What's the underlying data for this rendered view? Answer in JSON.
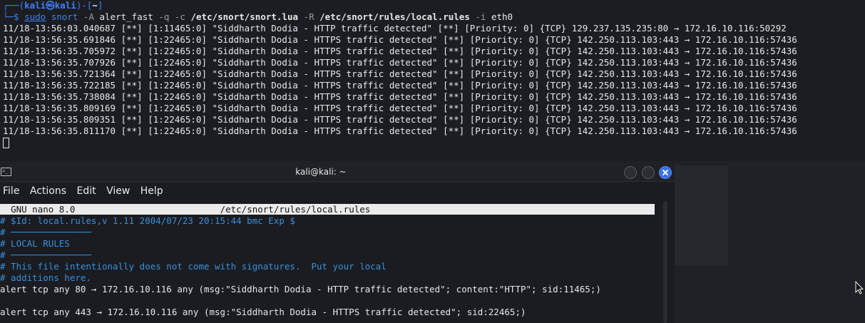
{
  "top_terminal": {
    "prompt": {
      "box_open": "┌──(",
      "user_host": "kali㉿kali",
      "box_close": ")-[",
      "cwd": "~",
      "box_end": "]",
      "arrow": "└─$",
      "sudo": "sudo",
      "cmd": "snort",
      "args": [
        {
          "t": "-A",
          "k": "flag"
        },
        {
          "t": "alert_fast",
          "k": "plain"
        },
        {
          "t": "-q",
          "k": "flag"
        },
        {
          "t": "-c",
          "k": "flag"
        },
        {
          "t": "/etc/snort/snort.lua",
          "k": "path"
        },
        {
          "t": "-R",
          "k": "flag"
        },
        {
          "t": "/etc/snort/rules/local.rules",
          "k": "path"
        },
        {
          "t": "-i",
          "k": "flag"
        },
        {
          "t": "eth0",
          "k": "plain"
        }
      ]
    },
    "alerts": [
      "11/18-13:56:03.040687 [**] [1:11465:0] \"Siddharth Dodia - HTTP traffic detected\" [**] [Priority: 0] {TCP} 129.237.135.235:80 → 172.16.10.116:50292",
      "11/18-13:56:35.691846 [**] [1:22465:0] \"Siddharth Dodia - HTTPS traffic detected\" [**] [Priority: 0] {TCP} 142.250.113.103:443 → 172.16.10.116:57436",
      "11/18-13:56:35.705972 [**] [1:22465:0] \"Siddharth Dodia - HTTPS traffic detected\" [**] [Priority: 0] {TCP} 142.250.113.103:443 → 172.16.10.116:57436",
      "11/18-13:56:35.707926 [**] [1:22465:0] \"Siddharth Dodia - HTTPS traffic detected\" [**] [Priority: 0] {TCP} 142.250.113.103:443 → 172.16.10.116:57436",
      "11/18-13:56:35.721364 [**] [1:22465:0] \"Siddharth Dodia - HTTPS traffic detected\" [**] [Priority: 0] {TCP} 142.250.113.103:443 → 172.16.10.116:57436",
      "11/18-13:56:35.722185 [**] [1:22465:0] \"Siddharth Dodia - HTTPS traffic detected\" [**] [Priority: 0] {TCP} 142.250.113.103:443 → 172.16.10.116:57436",
      "11/18-13:56:35.738084 [**] [1:22465:0] \"Siddharth Dodia - HTTPS traffic detected\" [**] [Priority: 0] {TCP} 142.250.113.103:443 → 172.16.10.116:57436",
      "11/18-13:56:35.809169 [**] [1:22465:0] \"Siddharth Dodia - HTTPS traffic detected\" [**] [Priority: 0] {TCP} 142.250.113.103:443 → 172.16.10.116:57436",
      "11/18-13:56:35.809351 [**] [1:22465:0] \"Siddharth Dodia - HTTPS traffic detected\" [**] [Priority: 0] {TCP} 142.250.113.103:443 → 172.16.10.116:57436",
      "11/18-13:56:35.811170 [**] [1:22465:0] \"Siddharth Dodia - HTTPS traffic detected\" [**] [Priority: 0] {TCP} 142.250.113.103:443 → 172.16.10.116:57436"
    ]
  },
  "nano_window": {
    "title": "kali@kali: ~",
    "menu": [
      "File",
      "Actions",
      "Edit",
      "View",
      "Help"
    ],
    "nano_version": "GNU nano 8.0",
    "filename": "/etc/snort/rules/local.rules",
    "lines": [
      {
        "t": "# $Id: local.rules,v 1.11 2004/07/23 20:15:44 bmc Exp $",
        "k": "comment"
      },
      {
        "t": "# ───────────────",
        "k": "comment"
      },
      {
        "t": "# LOCAL RULES",
        "k": "comment"
      },
      {
        "t": "# ───────────────",
        "k": "comment"
      },
      {
        "t": "# This file intentionally does not come with signatures.  Put your local",
        "k": "comment"
      },
      {
        "t": "# additions here.",
        "k": "comment"
      },
      {
        "t": "alert tcp any 80 → 172.16.10.116 any (msg:\"Siddharth Dodia - HTTP traffic detected\"; content:\"HTTP\"; sid:11465;)",
        "k": "rule"
      },
      {
        "t": "",
        "k": "rule"
      },
      {
        "t": "alert tcp any 443 → 172.16.10.116 any (msg:\"Siddharth Dodia - HTTPS traffic detected\"; sid:22465;)",
        "k": "rule"
      }
    ]
  },
  "colors": {
    "accent_blue": "#3f7ff7",
    "comment_blue": "#3a8fd8",
    "close_button": "#3a6fe0"
  }
}
